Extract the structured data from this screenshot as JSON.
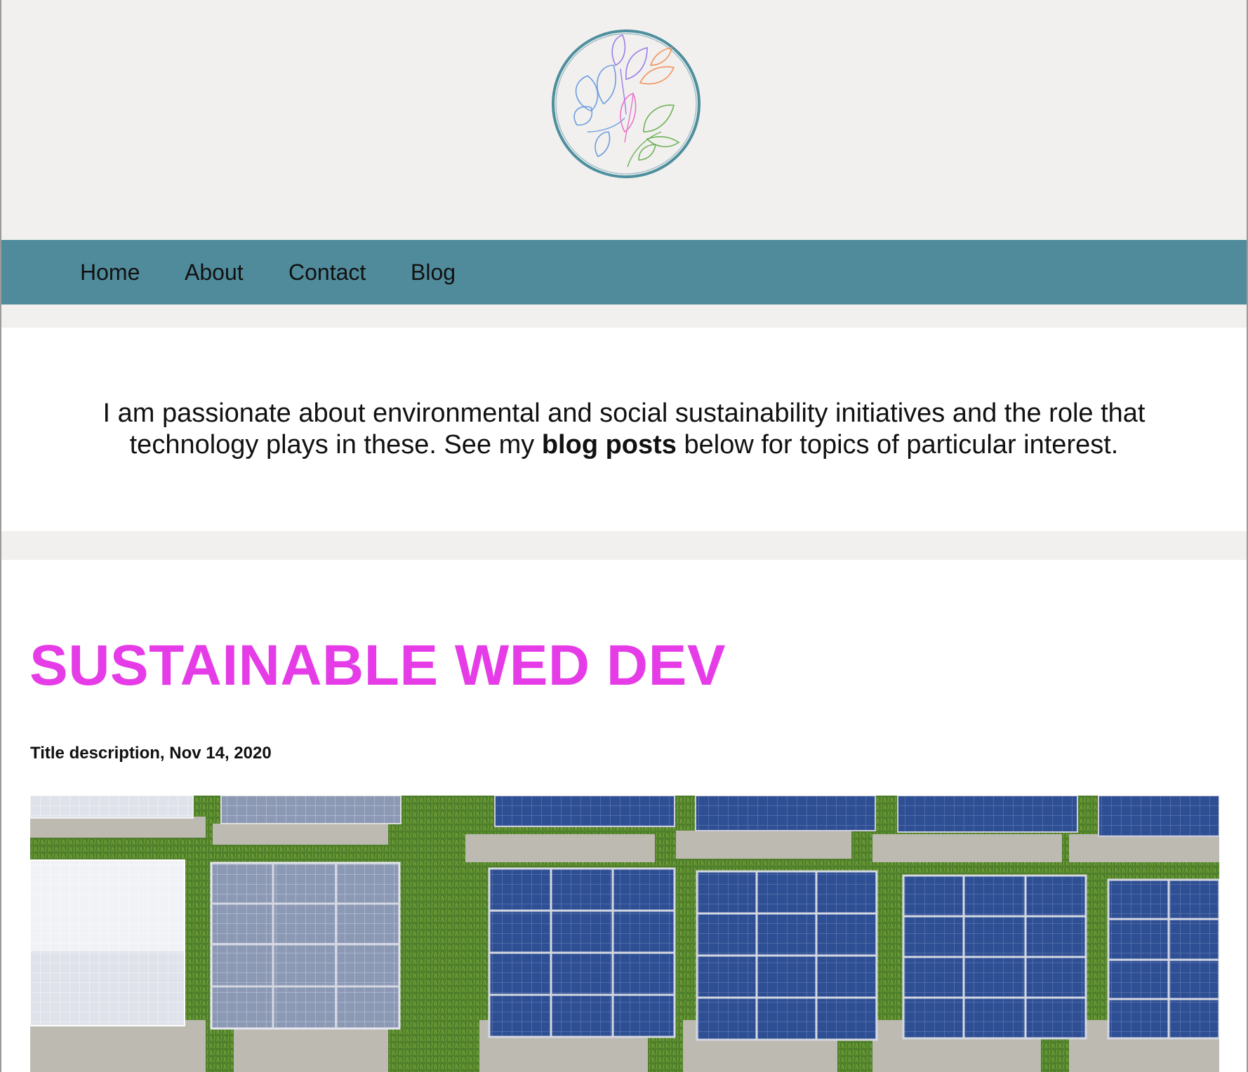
{
  "nav": {
    "items": [
      {
        "label": "Home"
      },
      {
        "label": "About"
      },
      {
        "label": "Contact"
      },
      {
        "label": "Blog"
      }
    ]
  },
  "intro": {
    "line1": "I am passionate about environmental and social sustainability initiatives and the role that",
    "line2_before": "technology plays in these. See my ",
    "line2_bold": "blog posts",
    "line2_after": " below for topics of particular interest."
  },
  "post": {
    "title": "SUSTAINABLE WED DEV",
    "meta": "Title description, Nov 14, 2020"
  },
  "colors": {
    "nav_bg": "#508b9b",
    "page_bg": "#f2f0ef",
    "title": "#e63ce8"
  },
  "icons": {
    "logo": "floral-line-art-logo",
    "post_image": "solar-panels-photo"
  }
}
